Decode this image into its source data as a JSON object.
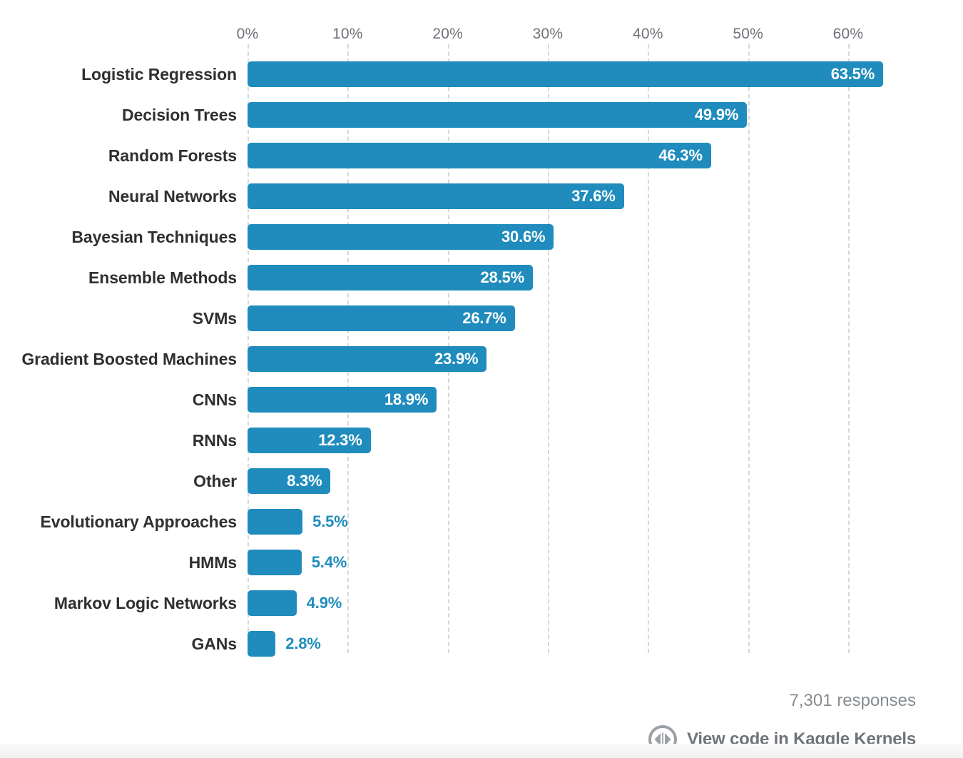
{
  "chart_data": {
    "type": "bar",
    "orientation": "horizontal",
    "title": "",
    "subtitle": "",
    "xlabel": "",
    "ylabel": "",
    "xlim": [
      0,
      63.5
    ],
    "grid": true,
    "legend": null,
    "axis": {
      "ticks": [
        {
          "value": 0,
          "label": "0%"
        },
        {
          "value": 10,
          "label": "10%"
        },
        {
          "value": 20,
          "label": "20%"
        },
        {
          "value": 30,
          "label": "30%"
        },
        {
          "value": 40,
          "label": "40%"
        },
        {
          "value": 50,
          "label": "50%"
        },
        {
          "value": 60,
          "label": "60%"
        }
      ]
    },
    "categories": [
      "Logistic Regression",
      "Decision Trees",
      "Random Forests",
      "Neural Networks",
      "Bayesian Techniques",
      "Ensemble Methods",
      "SVMs",
      "Gradient Boosted Machines",
      "CNNs",
      "RNNs",
      "Other",
      "Evolutionary Approaches",
      "HMMs",
      "Markov Logic Networks",
      "GANs"
    ],
    "values": [
      63.5,
      49.9,
      46.3,
      37.6,
      30.6,
      28.5,
      26.7,
      23.9,
      18.9,
      12.3,
      8.3,
      5.5,
      5.4,
      4.9,
      2.8
    ],
    "value_labels": [
      "63.5%",
      "49.9%",
      "46.3%",
      "37.6%",
      "30.6%",
      "28.5%",
      "26.7%",
      "23.9%",
      "18.9%",
      "12.3%",
      "8.3%",
      "5.5%",
      "5.4%",
      "4.9%",
      "2.8%"
    ],
    "label_placement": [
      "inside",
      "inside",
      "inside",
      "inside",
      "inside",
      "inside",
      "inside",
      "inside",
      "inside",
      "inside",
      "inside",
      "outside",
      "outside",
      "outside",
      "outside"
    ],
    "colors": {
      "bar": "#1f8cbd",
      "value_inside": "#ffffff",
      "value_outside": "#1f8cbd",
      "category_label": "#2f2f2f",
      "tick_label": "#6e7278",
      "gridline": "#d6d8da",
      "background": "#ffffff",
      "footer_text": "#6f747b",
      "responses_text": "#868b90"
    }
  },
  "footer": {
    "responses": "7,301 responses",
    "kernels_link_label": "View code in Kaggle Kernels",
    "kernels_icon_name": "code-circle-icon"
  }
}
